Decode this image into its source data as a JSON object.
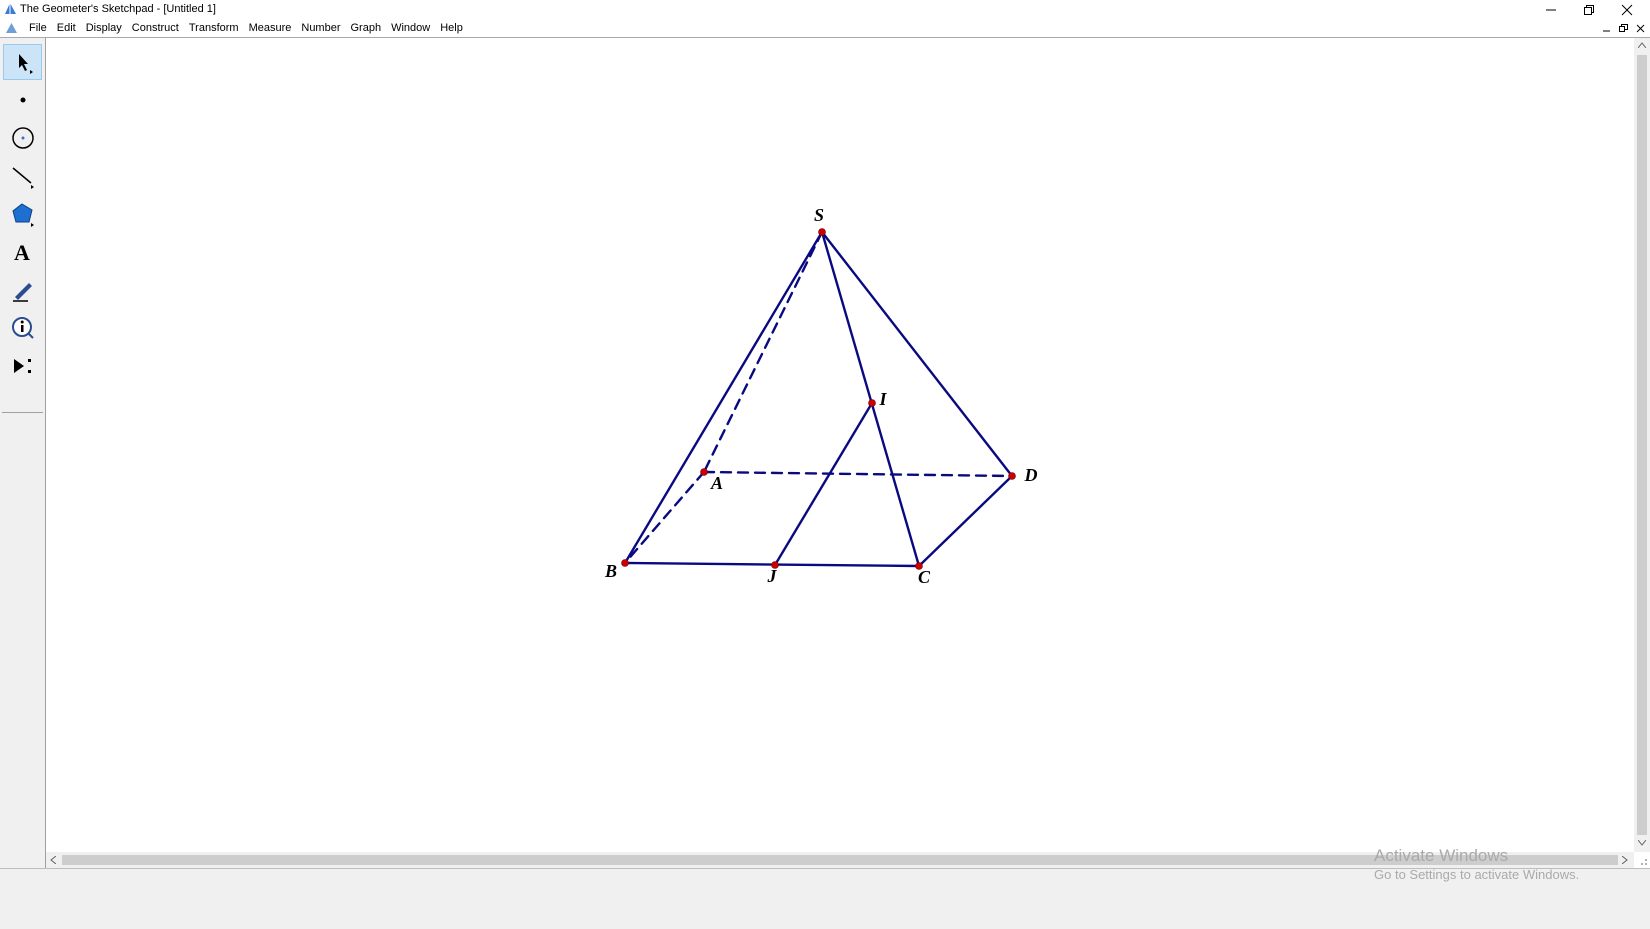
{
  "window": {
    "title": "The Geometer's Sketchpad - [Untitled 1]",
    "controls": [
      "minimize-icon",
      "restore-icon",
      "close-icon"
    ]
  },
  "menu": {
    "items": [
      "File",
      "Edit",
      "Display",
      "Construct",
      "Transform",
      "Measure",
      "Number",
      "Graph",
      "Window",
      "Help"
    ]
  },
  "toolbox": {
    "tools": [
      {
        "name": "arrow-select-tool",
        "active": true
      },
      {
        "name": "point-tool",
        "active": false
      },
      {
        "name": "compass-tool",
        "active": false
      },
      {
        "name": "straightedge-tool",
        "active": false
      },
      {
        "name": "polygon-tool",
        "active": false
      },
      {
        "name": "text-tool",
        "active": false
      },
      {
        "name": "marker-tool",
        "active": false
      },
      {
        "name": "information-tool",
        "active": false
      },
      {
        "name": "custom-tools-menu",
        "active": false
      }
    ]
  },
  "figure": {
    "points": [
      {
        "id": "S",
        "label": "S"
      },
      {
        "id": "A",
        "label": "A"
      },
      {
        "id": "B",
        "label": "B"
      },
      {
        "id": "C",
        "label": "C"
      },
      {
        "id": "D",
        "label": "D"
      },
      {
        "id": "I",
        "label": "I"
      },
      {
        "id": "J",
        "label": "J"
      }
    ],
    "solid_segments": [
      [
        "S",
        "B"
      ],
      [
        "S",
        "C"
      ],
      [
        "S",
        "D"
      ],
      [
        "B",
        "C"
      ],
      [
        "C",
        "D"
      ],
      [
        "I",
        "J"
      ]
    ],
    "dashed_segments": [
      [
        "S",
        "A"
      ],
      [
        "A",
        "B"
      ],
      [
        "A",
        "D"
      ]
    ],
    "line_color": "#0a0a80",
    "point_color": "#cc0000"
  },
  "watermark": {
    "title": "Activate Windows",
    "subtitle": "Go to Settings to activate Windows."
  }
}
